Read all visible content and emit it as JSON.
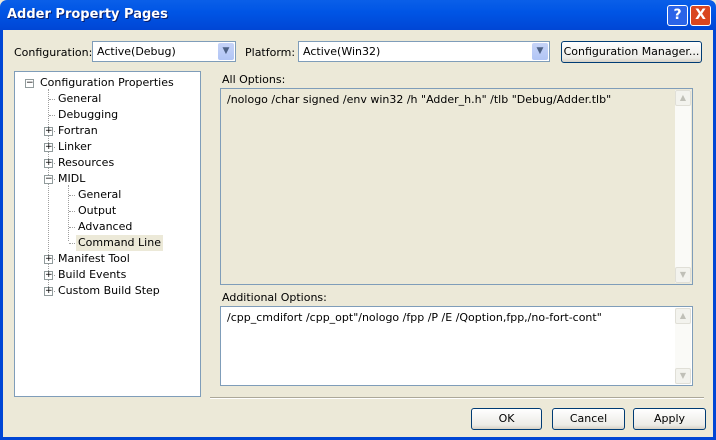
{
  "window": {
    "title": "Adder Property Pages",
    "help": "?",
    "close": "X"
  },
  "toolbar": {
    "configuration_label": "Configuration:",
    "configuration_value": "Active(Debug)",
    "platform_label": "Platform:",
    "platform_value": "Active(Win32)",
    "config_manager_label": "Configuration Manager..."
  },
  "tree": [
    {
      "label": "Configuration Properties",
      "level": 0,
      "expander": "minus"
    },
    {
      "label": "General",
      "level": 1,
      "expander": ""
    },
    {
      "label": "Debugging",
      "level": 1,
      "expander": ""
    },
    {
      "label": "Fortran",
      "level": 1,
      "expander": "plus"
    },
    {
      "label": "Linker",
      "level": 1,
      "expander": "plus"
    },
    {
      "label": "Resources",
      "level": 1,
      "expander": "plus"
    },
    {
      "label": "MIDL",
      "level": 1,
      "expander": "minus"
    },
    {
      "label": "General",
      "level": 2,
      "expander": ""
    },
    {
      "label": "Output",
      "level": 2,
      "expander": ""
    },
    {
      "label": "Advanced",
      "level": 2,
      "expander": ""
    },
    {
      "label": "Command Line",
      "level": 2,
      "expander": "",
      "selected": true
    },
    {
      "label": "Manifest Tool",
      "level": 1,
      "expander": "plus"
    },
    {
      "label": "Build Events",
      "level": 1,
      "expander": "plus"
    },
    {
      "label": "Custom Build Step",
      "level": 1,
      "expander": "plus"
    }
  ],
  "main": {
    "all_options_label": "All Options:",
    "all_options_value": "/nologo /char signed /env win32 /h \"Adder_h.h\" /tlb \"Debug/Adder.tlb\"",
    "additional_options_label": "Additional Options:",
    "additional_options_value": "/cpp_cmdifort /cpp_opt\"/nologo /fpp /P /E /Qoption,fpp,/no-fort-cont\""
  },
  "buttons": {
    "ok": "OK",
    "cancel": "Cancel",
    "apply": "Apply"
  }
}
